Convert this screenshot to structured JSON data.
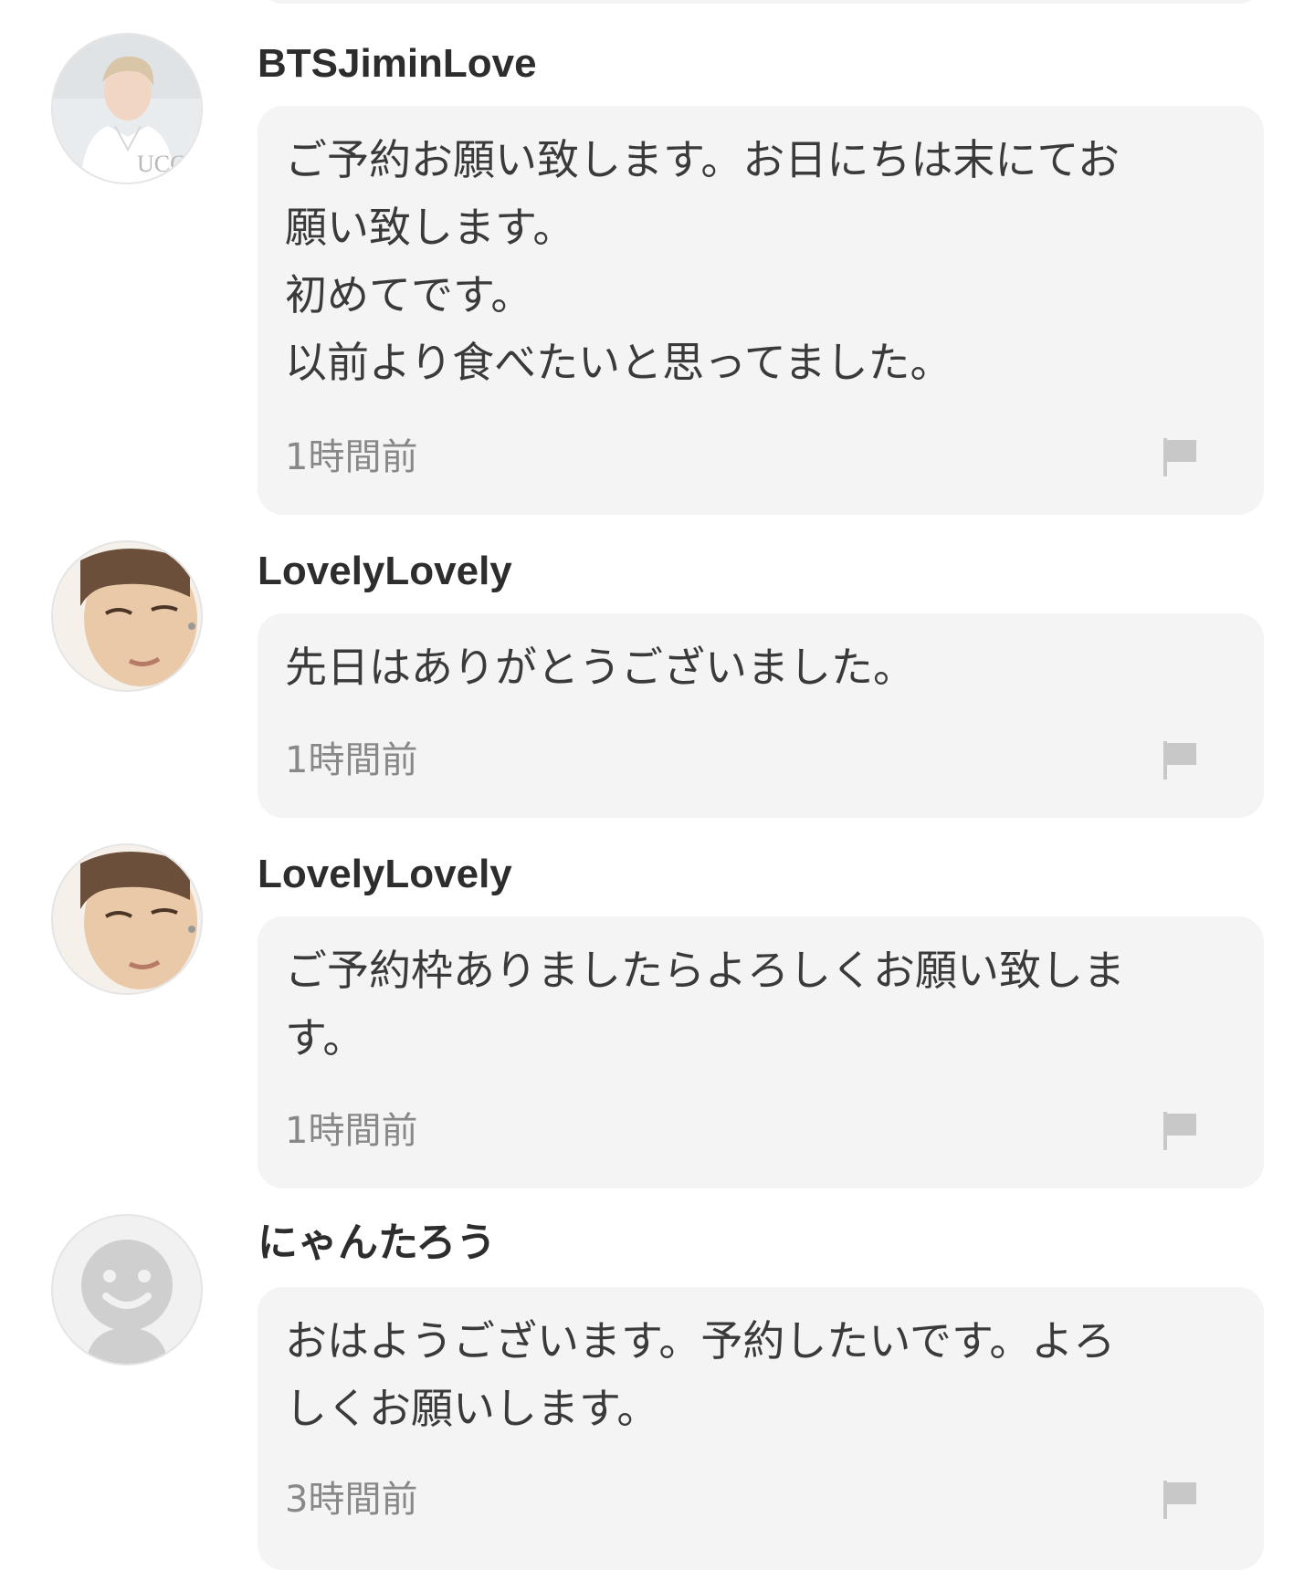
{
  "comments": [
    {
      "username": "BTSJiminLove",
      "avatar_icon": "user-photo-avatar",
      "lines": [
        "ご予約お願い致します。お日にちは末にてお",
        "願い致します。",
        "初めてです。",
        "以前より食べたいと思ってました。"
      ],
      "time": "1時間前",
      "flag_icon": "flag-icon"
    },
    {
      "username": "LovelyLovely",
      "avatar_icon": "user-photo-avatar",
      "lines": [
        "先日はありがとうございました。"
      ],
      "time": "1時間前",
      "flag_icon": "flag-icon"
    },
    {
      "username": "LovelyLovely",
      "avatar_icon": "user-photo-avatar",
      "lines": [
        "ご予約枠ありましたらよろしくお願い致しま",
        "す。"
      ],
      "time": "1時間前",
      "flag_icon": "flag-icon"
    },
    {
      "username": "にゃんたろう",
      "avatar_icon": "default-smiley-avatar",
      "lines": [
        "おはようございます。予約したいです。よろ",
        "しくお願いします。"
      ],
      "time": "3時間前",
      "flag_icon": "flag-icon"
    }
  ],
  "colors": {
    "bubble_background": "#f4f4f4",
    "username_text": "#2d2d2d",
    "message_text": "#3a3a3a",
    "timestamp_text": "#888888",
    "flag_icon": "#c8c8c8",
    "default_avatar": "#cfcfcf"
  }
}
